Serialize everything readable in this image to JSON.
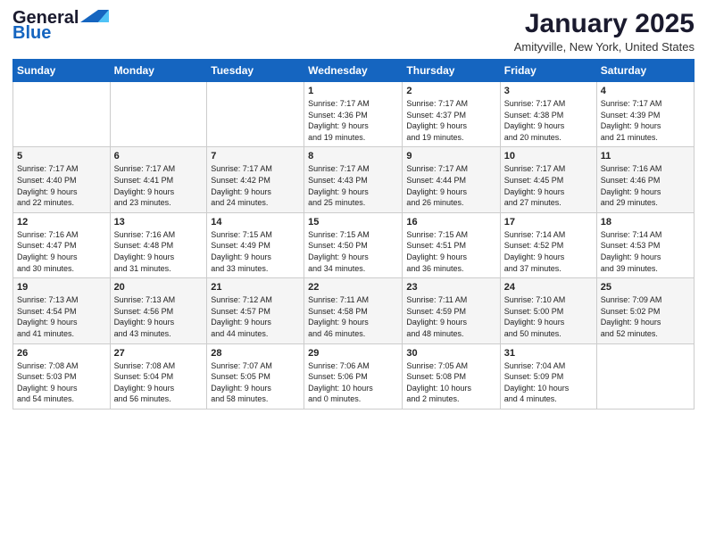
{
  "header": {
    "logo_line1": "General",
    "logo_line2": "Blue",
    "month": "January 2025",
    "location": "Amityville, New York, United States"
  },
  "days_of_week": [
    "Sunday",
    "Monday",
    "Tuesday",
    "Wednesday",
    "Thursday",
    "Friday",
    "Saturday"
  ],
  "weeks": [
    [
      {
        "day": "",
        "info": ""
      },
      {
        "day": "",
        "info": ""
      },
      {
        "day": "",
        "info": ""
      },
      {
        "day": "1",
        "info": "Sunrise: 7:17 AM\nSunset: 4:36 PM\nDaylight: 9 hours\nand 19 minutes."
      },
      {
        "day": "2",
        "info": "Sunrise: 7:17 AM\nSunset: 4:37 PM\nDaylight: 9 hours\nand 19 minutes."
      },
      {
        "day": "3",
        "info": "Sunrise: 7:17 AM\nSunset: 4:38 PM\nDaylight: 9 hours\nand 20 minutes."
      },
      {
        "day": "4",
        "info": "Sunrise: 7:17 AM\nSunset: 4:39 PM\nDaylight: 9 hours\nand 21 minutes."
      }
    ],
    [
      {
        "day": "5",
        "info": "Sunrise: 7:17 AM\nSunset: 4:40 PM\nDaylight: 9 hours\nand 22 minutes."
      },
      {
        "day": "6",
        "info": "Sunrise: 7:17 AM\nSunset: 4:41 PM\nDaylight: 9 hours\nand 23 minutes."
      },
      {
        "day": "7",
        "info": "Sunrise: 7:17 AM\nSunset: 4:42 PM\nDaylight: 9 hours\nand 24 minutes."
      },
      {
        "day": "8",
        "info": "Sunrise: 7:17 AM\nSunset: 4:43 PM\nDaylight: 9 hours\nand 25 minutes."
      },
      {
        "day": "9",
        "info": "Sunrise: 7:17 AM\nSunset: 4:44 PM\nDaylight: 9 hours\nand 26 minutes."
      },
      {
        "day": "10",
        "info": "Sunrise: 7:17 AM\nSunset: 4:45 PM\nDaylight: 9 hours\nand 27 minutes."
      },
      {
        "day": "11",
        "info": "Sunrise: 7:16 AM\nSunset: 4:46 PM\nDaylight: 9 hours\nand 29 minutes."
      }
    ],
    [
      {
        "day": "12",
        "info": "Sunrise: 7:16 AM\nSunset: 4:47 PM\nDaylight: 9 hours\nand 30 minutes."
      },
      {
        "day": "13",
        "info": "Sunrise: 7:16 AM\nSunset: 4:48 PM\nDaylight: 9 hours\nand 31 minutes."
      },
      {
        "day": "14",
        "info": "Sunrise: 7:15 AM\nSunset: 4:49 PM\nDaylight: 9 hours\nand 33 minutes."
      },
      {
        "day": "15",
        "info": "Sunrise: 7:15 AM\nSunset: 4:50 PM\nDaylight: 9 hours\nand 34 minutes."
      },
      {
        "day": "16",
        "info": "Sunrise: 7:15 AM\nSunset: 4:51 PM\nDaylight: 9 hours\nand 36 minutes."
      },
      {
        "day": "17",
        "info": "Sunrise: 7:14 AM\nSunset: 4:52 PM\nDaylight: 9 hours\nand 37 minutes."
      },
      {
        "day": "18",
        "info": "Sunrise: 7:14 AM\nSunset: 4:53 PM\nDaylight: 9 hours\nand 39 minutes."
      }
    ],
    [
      {
        "day": "19",
        "info": "Sunrise: 7:13 AM\nSunset: 4:54 PM\nDaylight: 9 hours\nand 41 minutes."
      },
      {
        "day": "20",
        "info": "Sunrise: 7:13 AM\nSunset: 4:56 PM\nDaylight: 9 hours\nand 43 minutes."
      },
      {
        "day": "21",
        "info": "Sunrise: 7:12 AM\nSunset: 4:57 PM\nDaylight: 9 hours\nand 44 minutes."
      },
      {
        "day": "22",
        "info": "Sunrise: 7:11 AM\nSunset: 4:58 PM\nDaylight: 9 hours\nand 46 minutes."
      },
      {
        "day": "23",
        "info": "Sunrise: 7:11 AM\nSunset: 4:59 PM\nDaylight: 9 hours\nand 48 minutes."
      },
      {
        "day": "24",
        "info": "Sunrise: 7:10 AM\nSunset: 5:00 PM\nDaylight: 9 hours\nand 50 minutes."
      },
      {
        "day": "25",
        "info": "Sunrise: 7:09 AM\nSunset: 5:02 PM\nDaylight: 9 hours\nand 52 minutes."
      }
    ],
    [
      {
        "day": "26",
        "info": "Sunrise: 7:08 AM\nSunset: 5:03 PM\nDaylight: 9 hours\nand 54 minutes."
      },
      {
        "day": "27",
        "info": "Sunrise: 7:08 AM\nSunset: 5:04 PM\nDaylight: 9 hours\nand 56 minutes."
      },
      {
        "day": "28",
        "info": "Sunrise: 7:07 AM\nSunset: 5:05 PM\nDaylight: 9 hours\nand 58 minutes."
      },
      {
        "day": "29",
        "info": "Sunrise: 7:06 AM\nSunset: 5:06 PM\nDaylight: 10 hours\nand 0 minutes."
      },
      {
        "day": "30",
        "info": "Sunrise: 7:05 AM\nSunset: 5:08 PM\nDaylight: 10 hours\nand 2 minutes."
      },
      {
        "day": "31",
        "info": "Sunrise: 7:04 AM\nSunset: 5:09 PM\nDaylight: 10 hours\nand 4 minutes."
      },
      {
        "day": "",
        "info": ""
      }
    ]
  ]
}
